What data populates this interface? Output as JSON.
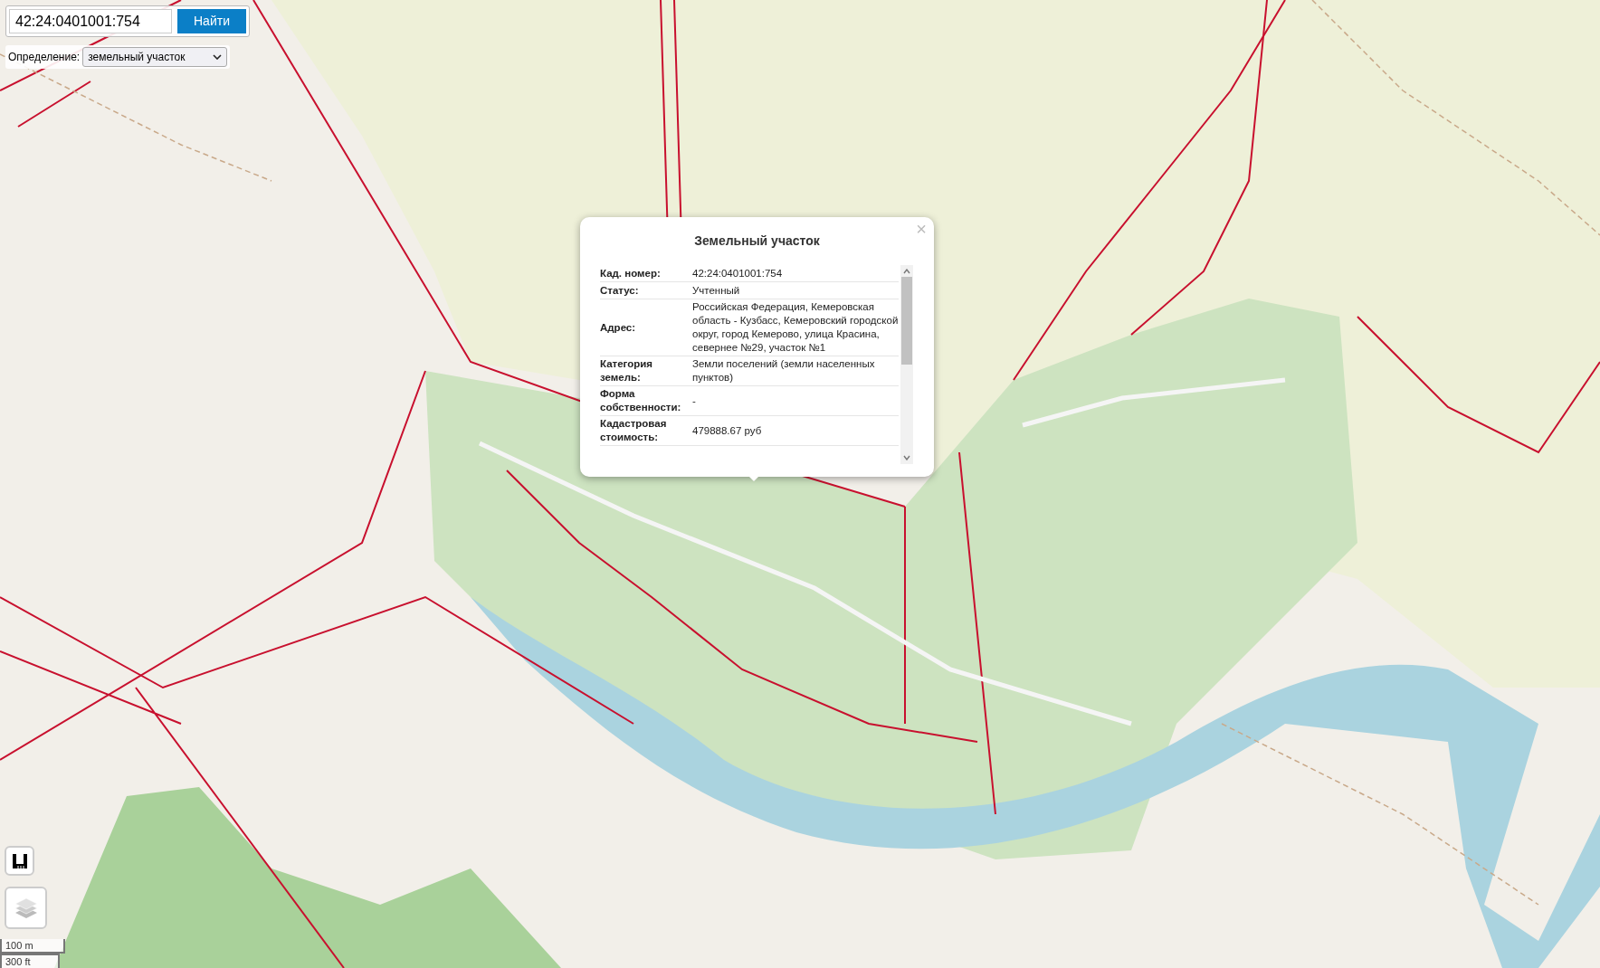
{
  "search": {
    "value": "42:24:0401001:754",
    "button": "Найти"
  },
  "definition": {
    "label": "Определение:",
    "value": "земельный участок"
  },
  "popup": {
    "title": "Земельный участок",
    "close": "×",
    "rows": [
      {
        "label": "Кад. номер:",
        "value": "42:24:0401001:754"
      },
      {
        "label": "Статус:",
        "value": "Учтенный"
      },
      {
        "label": "Адрес:",
        "value": "Российская Федерация, Кемеровская область - Кузбасс, Кемеровский городской округ, город Кемерово, улица Красина, севернее №29, участок №1"
      },
      {
        "label": "Категория земель:",
        "value": "Земли поселений (земли населенных пунктов)"
      },
      {
        "label": "Форма собственности:",
        "value": "-"
      },
      {
        "label": "Кадастровая стоимость:",
        "value": "479888.67 руб"
      }
    ]
  },
  "scale": {
    "metric": "100 m",
    "imperial": "300 ft"
  }
}
